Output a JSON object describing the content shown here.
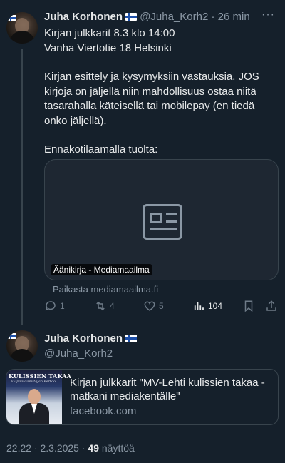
{
  "tweet1": {
    "name": "Juha Korhonen",
    "handle": "@Juha_Korh2",
    "time": "26 min",
    "more": "···",
    "lines": [
      "Kirjan julkkarit 8.3 klo 14:00",
      "Vanha Viertotie 18 Helsinki",
      "",
      "Kirjan esittely ja kysymyksiin vastauksia. JOS kirjoja on jäljellä niin mahdollisuus ostaa niitä tasarahalla käteisellä tai mobilepay (en tiedä onko jäljellä).",
      "",
      "Ennakotilaamalla tuolta:"
    ],
    "card": {
      "label": "Äänikirja - Mediamaailma",
      "source": "Paikasta mediamaailma.fi"
    },
    "actions": {
      "replies": "1",
      "retweets": "4",
      "likes": "5",
      "views": "104"
    }
  },
  "tweet2": {
    "name": "Juha Korhonen",
    "handle": "@Juha_Korh2",
    "link": {
      "thumb_title": "KULISSIEN TAKAA",
      "thumb_subtitle": "Ex-päätoimittajan kertoo",
      "title": "Kirjan julkkarit \"MV-Lehti kulissien takaa - matkani mediakentälle\"",
      "domain": "facebook.com"
    },
    "meta": {
      "time": "22.22 · 2.3.2025 · ",
      "views": "49",
      "views_label": " näyttöä"
    }
  }
}
